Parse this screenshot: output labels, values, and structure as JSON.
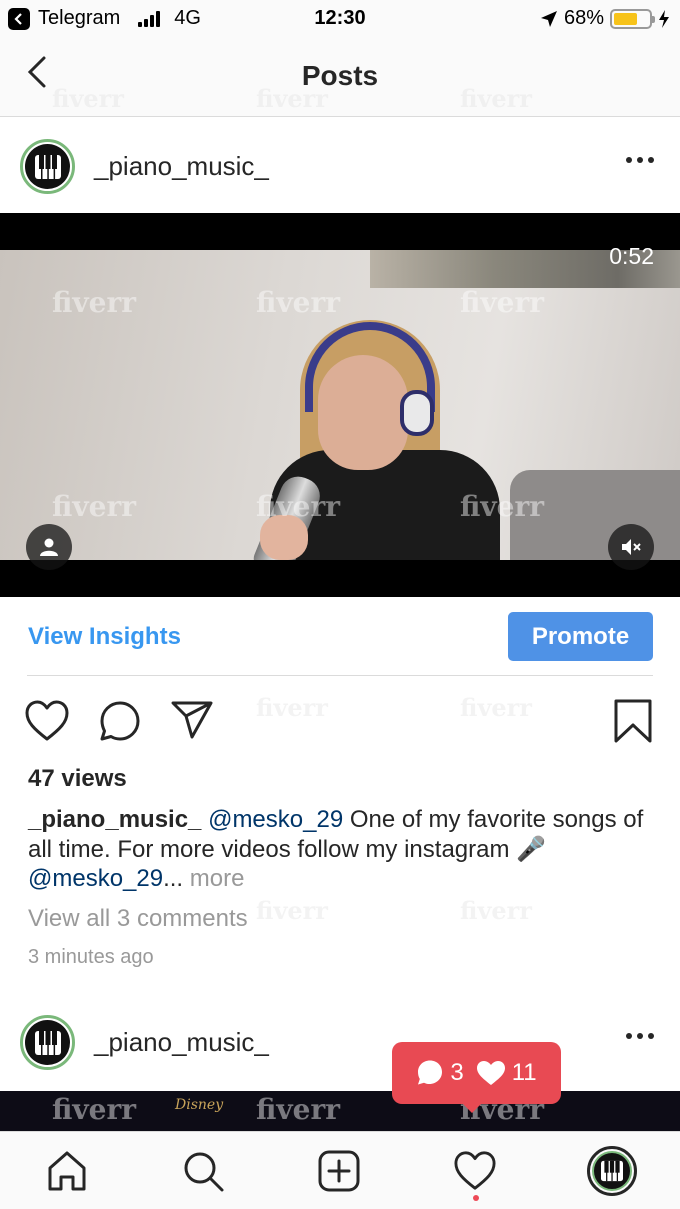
{
  "status_bar": {
    "back_app": "Telegram",
    "network": "4G",
    "time": "12:30",
    "battery": "68%",
    "battery_level": 0.68,
    "icons": [
      "back-chevron-icon",
      "signal-icon",
      "location-arrow-icon",
      "battery-icon",
      "charging-bolt-icon"
    ]
  },
  "header": {
    "title": "Posts",
    "back_icon": "chevron-left-icon"
  },
  "watermark_text": "fiverr",
  "post": {
    "username": "_piano_music_",
    "avatar_icon": "piano-keys-icon",
    "more_icon": "more-dots-icon",
    "video": {
      "duration": "0:52",
      "user_tag_icon": "person-icon",
      "mute_icon": "speaker-muted-icon"
    },
    "insights_label": "View Insights",
    "promote_label": "Promote",
    "actions": {
      "like_icon": "heart-icon",
      "comment_icon": "comment-icon",
      "share_icon": "paper-plane-icon",
      "save_icon": "bookmark-icon"
    },
    "views": "47 views",
    "caption": {
      "user": "_piano_music_",
      "mention_1": "@mesko_29",
      "text": " One of my favorite songs of all time. For more videos follow my instagram 🎤 ",
      "mention_2": "@mesko_29",
      "ellipsis": "...",
      "more": " more"
    },
    "view_comments": "View all 3 comments",
    "time_ago": "3 minutes ago"
  },
  "post2": {
    "username": "_piano_music_",
    "disney_text": "Disney"
  },
  "notification": {
    "comments": "3",
    "likes": "11",
    "color": "#e84a53"
  },
  "tab_bar": {
    "items": [
      "home-icon",
      "search-icon",
      "new-post-icon",
      "activity-heart-icon",
      "profile-avatar-icon"
    ]
  },
  "colors": {
    "link_blue": "#3897f0",
    "promote_blue": "#4f92e6",
    "mention_blue": "#003569",
    "muted_gray": "#999999"
  }
}
